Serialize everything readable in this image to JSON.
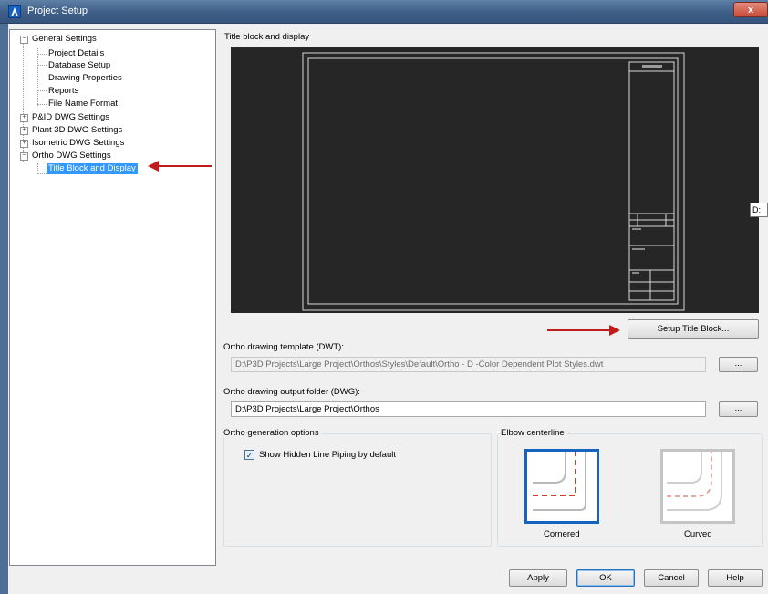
{
  "window": {
    "title": "Project Setup",
    "close_glyph": "x"
  },
  "tree": {
    "general": {
      "label": "General Settings",
      "expander": "−"
    },
    "general_children": [
      "Project Details",
      "Database Setup",
      "Drawing Properties",
      "Reports",
      "File Name Format"
    ],
    "pid": {
      "label": "P&ID DWG Settings",
      "expander": "+"
    },
    "plant3d": {
      "label": "Plant 3D DWG Settings",
      "expander": "+"
    },
    "iso": {
      "label": "Isometric DWG Settings",
      "expander": "+"
    },
    "ortho": {
      "label": "Ortho DWG Settings",
      "expander": "−"
    },
    "selected_child": "Title Block and Display"
  },
  "panel": {
    "section_title": "Title block and display",
    "setup_title_block_label": "Setup Title Block...",
    "edge_label": "D:",
    "template": {
      "label": "Ortho drawing template (DWT):",
      "value": "D:\\P3D Projects\\Large Project\\Orthos\\Styles\\Default\\Ortho - D -Color Dependent Plot Styles.dwt",
      "browse_label": "..."
    },
    "output": {
      "label": "Ortho drawing output folder (DWG):",
      "value": "D:\\P3D Projects\\Large Project\\Orthos",
      "browse_label": "..."
    },
    "generation": {
      "title": "Ortho generation options",
      "checkbox_label": "Show Hidden Line Piping by default",
      "checked_glyph": "✓",
      "checked": true
    },
    "elbow": {
      "title": "Elbow centerline",
      "options": [
        "Cornered",
        "Curved"
      ],
      "selected": "Cornered"
    }
  },
  "buttons": {
    "apply": "Apply",
    "ok": "OK",
    "cancel": "Cancel",
    "help": "Help"
  },
  "colors": {
    "accent": "#3399ff",
    "selection_border": "#1565c0",
    "annotation_arrow": "#c01c1c",
    "centerline": "#d23a3a"
  },
  "icons": {
    "app": "autocad-plant-icon",
    "close": "close-icon",
    "annotation": "red-arrow-icon"
  }
}
